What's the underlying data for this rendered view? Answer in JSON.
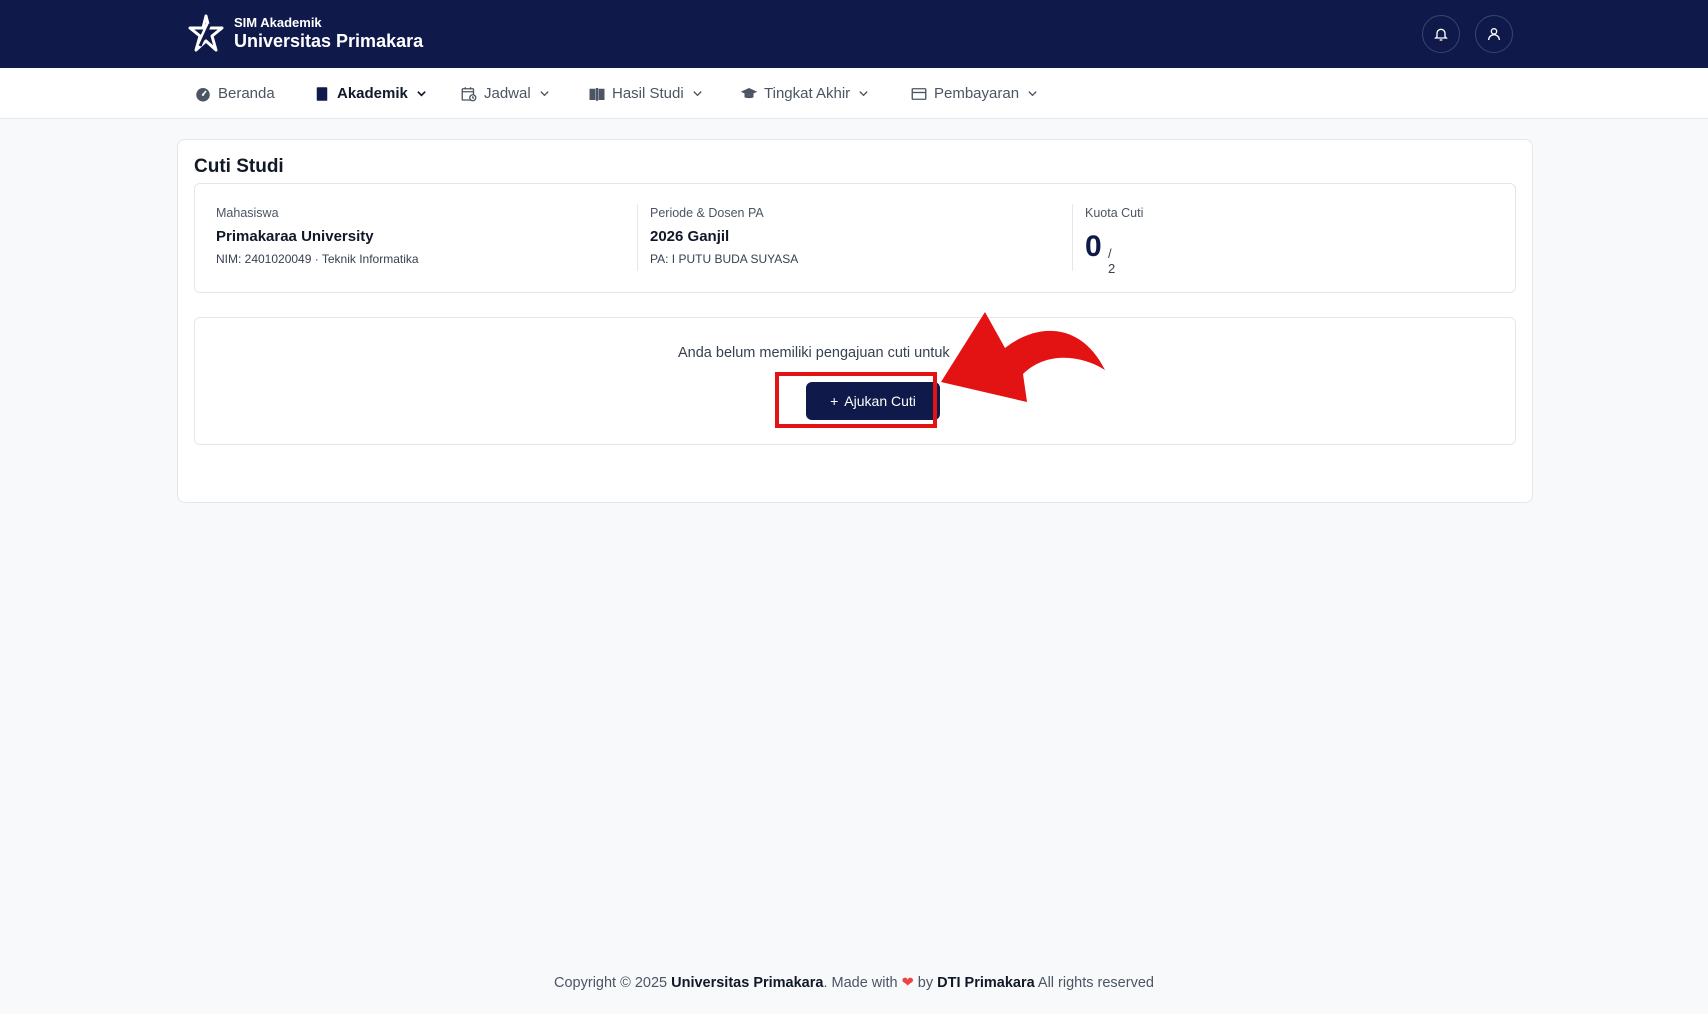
{
  "header": {
    "app_subtitle": "SIM Akademik",
    "app_title": "Universitas Primakara"
  },
  "nav": {
    "items": [
      {
        "label": "Beranda",
        "icon": "dashboard-icon",
        "dropdown": false
      },
      {
        "label": "Akademik",
        "icon": "book-icon",
        "dropdown": true,
        "active": true
      },
      {
        "label": "Jadwal",
        "icon": "calendar-clock-icon",
        "dropdown": true
      },
      {
        "label": "Hasil Studi",
        "icon": "open-book-icon",
        "dropdown": true
      },
      {
        "label": "Tingkat Akhir",
        "icon": "graduation-cap-icon",
        "dropdown": true
      },
      {
        "label": "Pembayaran",
        "icon": "wallet-icon",
        "dropdown": true
      }
    ]
  },
  "page": {
    "title": "Cuti Studi",
    "mahasiswa": {
      "label": "Mahasiswa",
      "name": "Primakaraa University",
      "detail": "NIM: 2401020049 · Teknik Informatika"
    },
    "periode": {
      "label": "Periode & Dosen PA",
      "value": "2026 Ganjil",
      "detail": "PA: I PUTU BUDA SUYASA"
    },
    "kuota": {
      "label": "Kuota Cuti",
      "used": "0",
      "total": "/ 2"
    },
    "empty_message": "Anda belum memiliki pengajuan cuti untuk",
    "ajukan_button": "Ajukan Cuti"
  },
  "footer": {
    "prefix": "Copyright © 2025 ",
    "org": "Universitas Primakara",
    "made_with": ". Made with ",
    "by": " by ",
    "team": "DTI Primakara",
    "suffix": " All rights reserved"
  },
  "colors": {
    "primary": "#101a4a",
    "highlight": "#e41313",
    "heart": "#ef4444"
  }
}
